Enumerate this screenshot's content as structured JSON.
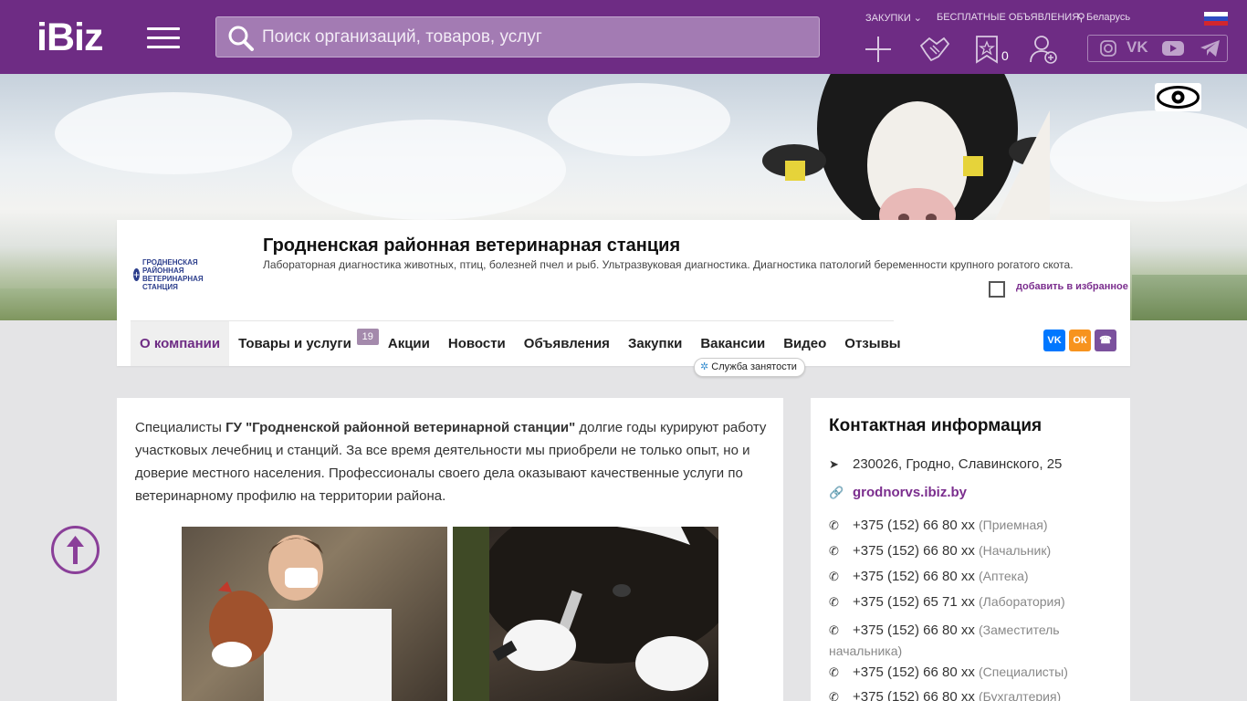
{
  "header": {
    "logo": "iBiz",
    "search_placeholder": "Поиск организаций, товаров, услуг",
    "links": {
      "purchases": "ЗАКУПКИ",
      "ads": "БЕСПЛАТНЫЕ ОБЪЯВЛЕНИЯ",
      "region": "Беларусь"
    },
    "favorites_count": "0",
    "social": [
      "instagram",
      "vk",
      "youtube",
      "telegram"
    ]
  },
  "company": {
    "name": "Гродненская районная ветеринарная станция",
    "description": "Лабораторная диагностика животных, птиц, болезней пчел и рыб. Ультразвуковая диагностика. Диагностика патологий беременности крупного рогатого скота.",
    "logo_text": "ГРОДНЕНСКАЯ РАЙОННАЯ ВЕТЕРИНАРНАЯ СТАНЦИЯ",
    "add_favorite": "добавить в избранное"
  },
  "nav": {
    "items": [
      {
        "label": "О компании"
      },
      {
        "label": "Товары и услуги",
        "badge": "19"
      },
      {
        "label": "Акции"
      },
      {
        "label": "Новости"
      },
      {
        "label": "Объявления"
      },
      {
        "label": "Закупки"
      },
      {
        "label": "Вакансии"
      },
      {
        "label": "Видео"
      },
      {
        "label": "Отзывы"
      }
    ],
    "employment_badge": "Служба занятости"
  },
  "share": [
    "vk",
    "ok",
    "viber"
  ],
  "about": {
    "p_prefix": "Специалисты ",
    "p_bold": "ГУ \"Гродненской районной ветеринарной станции\"",
    "p_rest": " долгие годы курируют работу участковых лечебниц и станций. За все время деятельности мы приобрели не только опыт, но и доверие местного населения. Профессионалы своего дела  оказывают качественные услуги по ветеринарному профилю на территории района."
  },
  "contacts": {
    "title": "Контактная информация",
    "address": "230026, Гродно, Славинского, 25",
    "site": "grodnorvs.ibiz.by",
    "phones": [
      {
        "number": "+375 (152) 66 80 xx",
        "note": "(Приемная)"
      },
      {
        "number": "+375 (152) 66 80 xx",
        "note": "(Начальник)"
      },
      {
        "number": "+375 (152) 66 80 xx",
        "note": "(Аптека)"
      },
      {
        "number": "+375 (152) 65 71 xx",
        "note": "(Лаборатория)"
      },
      {
        "number": "+375 (152) 66 80 xx",
        "note": "(Заместитель начальника)"
      },
      {
        "number": "+375 (152) 66 80 xx",
        "note": "(Специалисты)"
      },
      {
        "number": "+375 (152) 66 80 xx",
        "note": "(Бухгалтерия)"
      }
    ]
  },
  "colors": {
    "brand": "#6e2c84",
    "accent": "#7b2e8e"
  }
}
